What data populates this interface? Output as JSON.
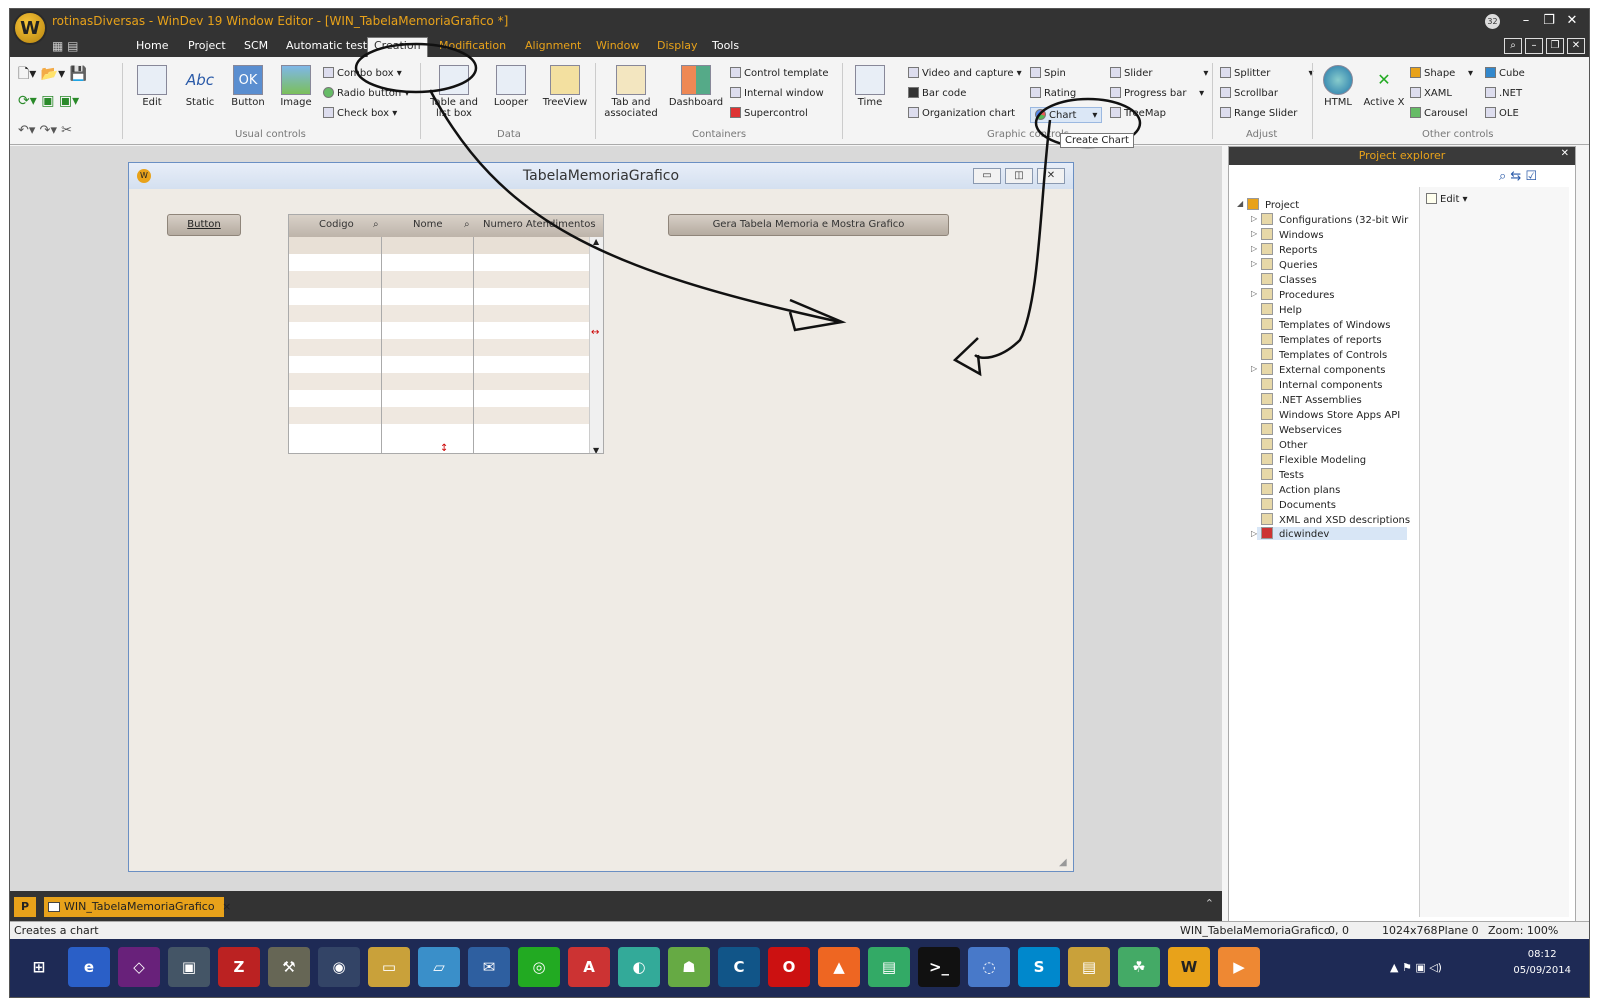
{
  "window": {
    "title": "rotinasDiversas - WinDev 19  Window Editor - [WIN_TabelaMemoriaGrafico *]",
    "badge": "32",
    "logo": "W"
  },
  "menu": [
    "Home",
    "Project",
    "SCM",
    "Automatic tests",
    "Creation",
    "Modification",
    "Alignment",
    "Window",
    "Display",
    "Tools"
  ],
  "ribbon": {
    "usual": {
      "label": "Usual controls",
      "edit": "Edit",
      "static": "Static",
      "static_icon": "Abc",
      "button": "Button",
      "button_icon": "OK",
      "image": "Image",
      "combo": "Combo box",
      "radio": "Radio button",
      "check": "Check box"
    },
    "data": {
      "label": "Data",
      "table": "Table and list box",
      "looper": "Looper",
      "treeview": "TreeView"
    },
    "containers": {
      "label": "Containers",
      "tab": "Tab and associated",
      "dashboard": "Dashboard",
      "control_template": "Control template",
      "internal_window": "Internal window",
      "supercontrol": "Supercontrol"
    },
    "graphic": {
      "label": "Graphic controls",
      "time": "Time",
      "video": "Video and capture",
      "barcode": "Bar code",
      "orgchart": "Organization chart",
      "spin": "Spin",
      "rating": "Rating",
      "chart": "Chart",
      "slider": "Slider",
      "progress": "Progress bar",
      "treemap": "TreeMap",
      "tooltip": "Create Chart"
    },
    "adjust": {
      "label": "Adjust",
      "splitter": "Splitter",
      "scrollbar": "Scrollbar",
      "range_slider": "Range Slider"
    },
    "other": {
      "label": "Other controls",
      "html": "HTML",
      "activex": "Active X",
      "shape": "Shape",
      "xaml": "XAML",
      "carousel": "Carousel",
      "cube": "Cube",
      "net": ".NET",
      "ole": "OLE"
    }
  },
  "form": {
    "title": "TabelaMemoriaGrafico",
    "button_label": "Button",
    "gera_label": "Gera Tabela Memoria e Mostra Grafico",
    "table_headers": [
      "Codigo",
      "Nome",
      "Numero Atendimentos"
    ]
  },
  "explorer": {
    "title": "Project explorer",
    "edit": "Edit",
    "items": [
      "Project",
      "Configurations (32-bit Wir",
      "Windows",
      "Reports",
      "Queries",
      "Classes",
      "Procedures",
      "Help",
      "Templates of Windows",
      "Templates of reports",
      "Templates of Controls",
      "External components",
      "Internal components",
      ".NET Assemblies",
      "Windows Store Apps API",
      "Webservices",
      "Other",
      "Flexible Modeling",
      "Tests",
      "Action plans",
      "Documents",
      "XML and XSD descriptions",
      "dicwindev"
    ]
  },
  "tabbar": {
    "file": "WIN_TabelaMemoriaGrafico",
    "close": "×"
  },
  "status": {
    "left": "Creates a chart",
    "window": "WIN_TabelaMemoriaGrafico",
    "coords": "0, 0",
    "resolution": "1024x768",
    "plane": "Plane 0",
    "zoom": "Zoom: 100%"
  },
  "clock": {
    "time": "08:12",
    "date": "05/09/2014"
  }
}
